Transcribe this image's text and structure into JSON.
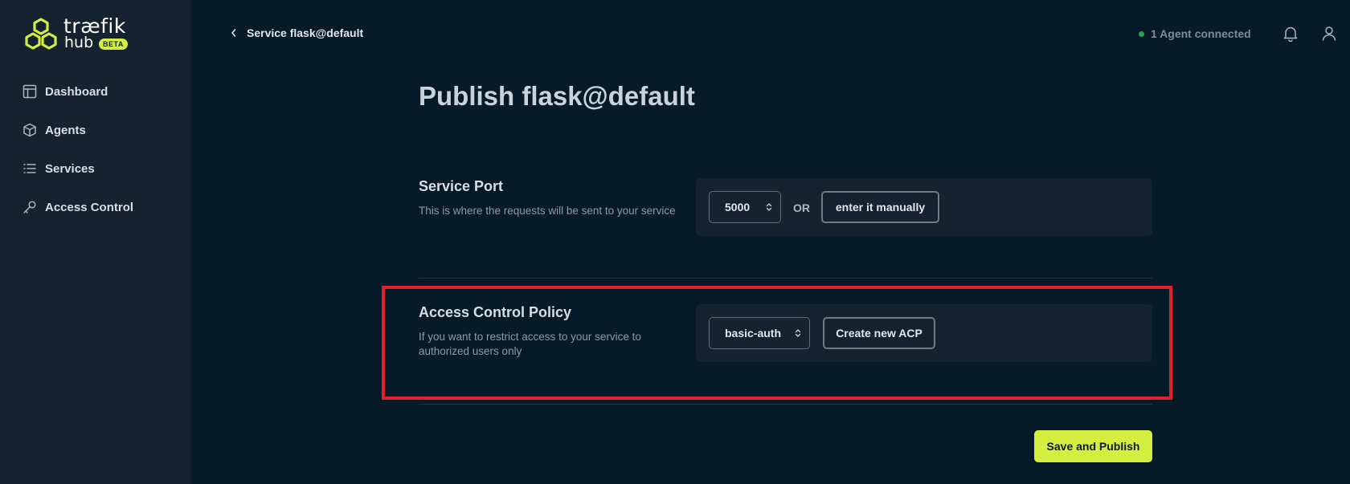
{
  "logo": {
    "word": "træfik",
    "sub": "hub",
    "badge": "BETA"
  },
  "sidebar": {
    "items": [
      {
        "label": "Dashboard",
        "icon": "dashboard-icon"
      },
      {
        "label": "Agents",
        "icon": "cube-icon"
      },
      {
        "label": "Services",
        "icon": "list-icon"
      },
      {
        "label": "Access Control",
        "icon": "key-icon"
      }
    ]
  },
  "header": {
    "back_label": "Service flask@default",
    "agent_status": "1 Agent connected",
    "status_color": "#23a35a"
  },
  "main": {
    "title": "Publish flask@default",
    "service_port": {
      "title": "Service Port",
      "description": "This is where the requests will be sent to your service",
      "selected_port": "5000",
      "or_text": "OR",
      "manual_button": "enter it manually"
    },
    "access_control": {
      "title": "Access Control Policy",
      "description": "If you want to restrict access to your service to authorized users only",
      "selected_policy": "basic-auth",
      "create_button": "Create new ACP"
    },
    "save_button": "Save and Publish"
  },
  "colors": {
    "accent": "#d4ee3f",
    "background": "#071a28",
    "sidebar": "#14232f",
    "highlight": "#e0222c"
  }
}
